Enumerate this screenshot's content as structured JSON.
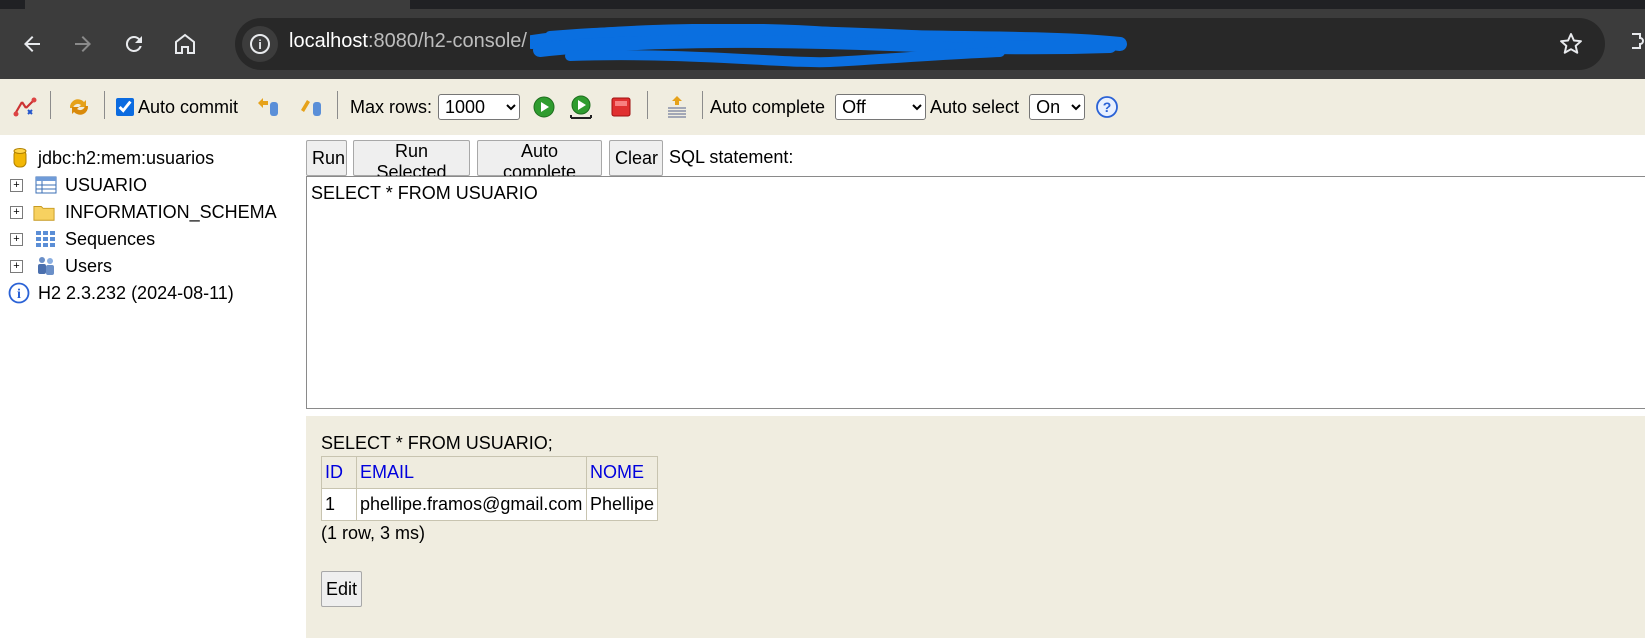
{
  "browser": {
    "url_host": "localhost",
    "url_path": ":8080/h2-console/",
    "icons": [
      "back-icon",
      "forward-icon",
      "reload-icon",
      "home-icon",
      "site-info-icon",
      "bookmark-star-icon"
    ]
  },
  "toolbar": {
    "auto_commit_label": "Auto commit",
    "auto_commit_checked": true,
    "max_rows_label": "Max rows:",
    "max_rows_value": "1000",
    "auto_complete_label": "Auto complete",
    "auto_complete_value": "Off",
    "auto_select_label": "Auto select",
    "auto_select_value": "On"
  },
  "tree": {
    "connection": "jdbc:h2:mem:usuarios",
    "items": [
      {
        "label": "USUARIO",
        "icon": "table-icon"
      },
      {
        "label": "INFORMATION_SCHEMA",
        "icon": "folder-icon"
      },
      {
        "label": "Sequences",
        "icon": "sequences-icon"
      },
      {
        "label": "Users",
        "icon": "users-icon"
      }
    ],
    "version": "H2 2.3.232 (2024-08-11)"
  },
  "query": {
    "run_label": "Run",
    "run_selected_label": "Run Selected",
    "auto_complete_label": "Auto complete",
    "clear_label": "Clear",
    "sql_statement_label": "SQL statement:",
    "sql_text": "SELECT * FROM USUARIO"
  },
  "result": {
    "sql": "SELECT * FROM USUARIO;",
    "columns": [
      "ID",
      "EMAIL",
      "NOME"
    ],
    "rows": [
      [
        "1",
        "phellipe.framos@gmail.com",
        "Phellipe"
      ]
    ],
    "meta": "(1 row, 3 ms)",
    "edit_label": "Edit"
  },
  "colors": {
    "toolbar_bg": "#f0ede0",
    "header_link": "#0000dd",
    "redaction_blue": "#0a6fe0"
  }
}
